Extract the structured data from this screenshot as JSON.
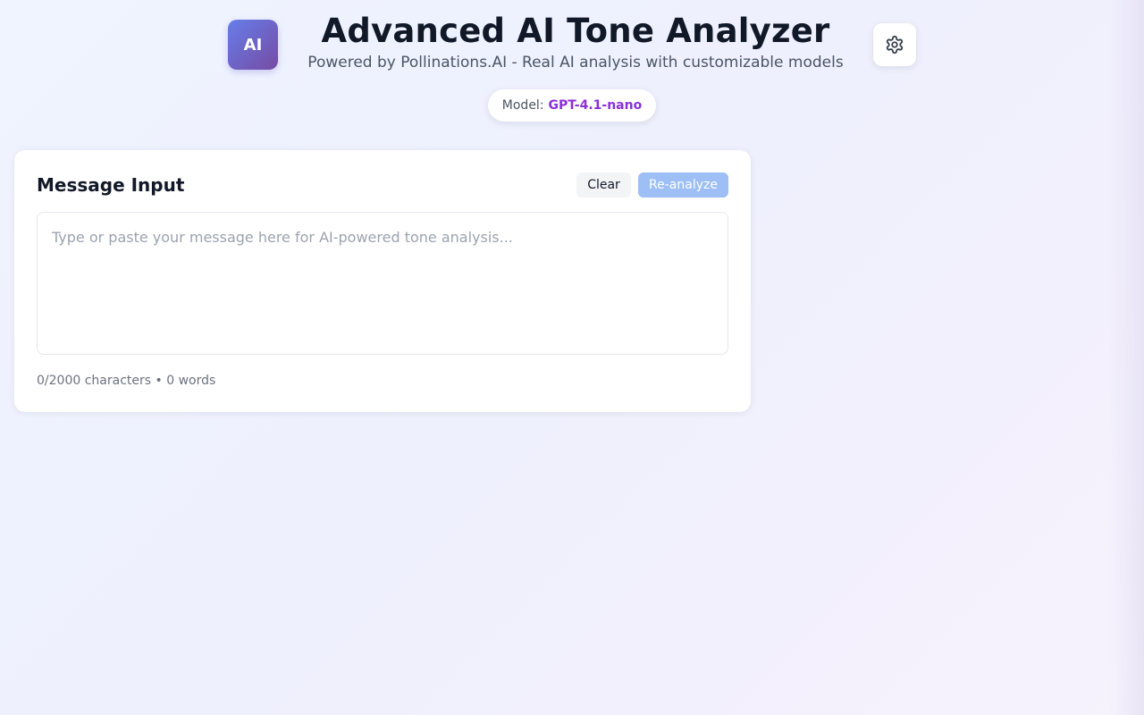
{
  "header": {
    "logo_text": "AI",
    "title": "Advanced AI Tone Analyzer",
    "subtitle": "Powered by Pollinations.AI - Real AI analysis with customizable models",
    "settings_icon": "gear-icon"
  },
  "model": {
    "label": "Model:",
    "name": "GPT-4.1-nano"
  },
  "input_card": {
    "title": "Message Input",
    "clear_label": "Clear",
    "reanalyze_label": "Re-analyze",
    "message_value": "",
    "placeholder": "Type or paste your message here for AI-powered tone analysis...",
    "char_count": "0/2000 characters",
    "separator": "•",
    "word_count": "0 words"
  },
  "colors": {
    "accent_purple": "#8b2fd8",
    "logo_gradient_start": "#667eea",
    "logo_gradient_end": "#764ba2",
    "reanalyze_disabled": "#9dbff5"
  }
}
